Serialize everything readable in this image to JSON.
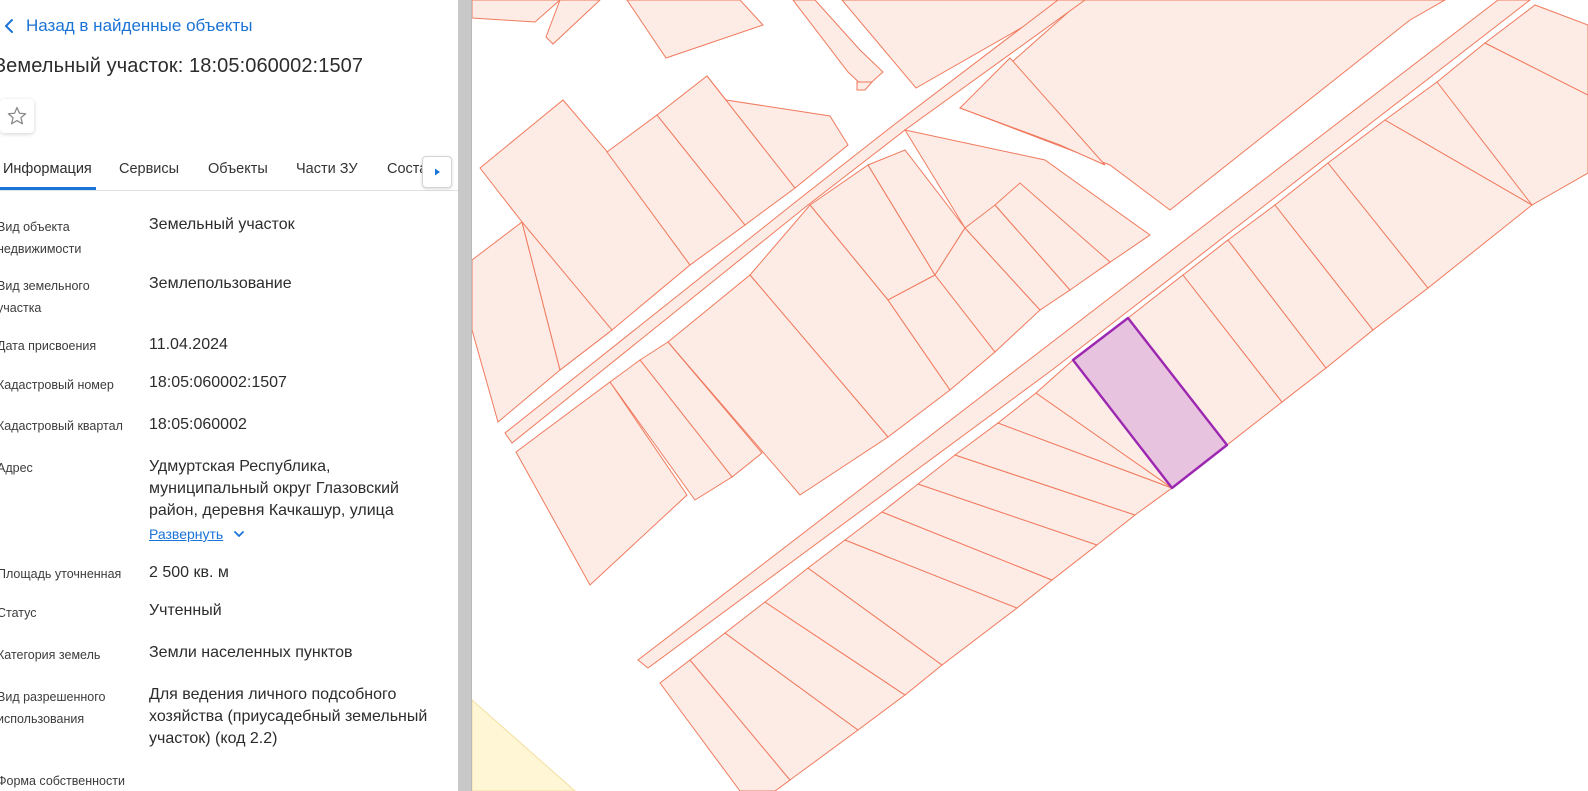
{
  "back_link": {
    "label": "Назад в найденные объекты"
  },
  "title": "Земельный участок: 18:05:060002:1507",
  "tabs": [
    {
      "label": "Информация",
      "active": true
    },
    {
      "label": "Сервисы",
      "active": false
    },
    {
      "label": "Объекты",
      "active": false
    },
    {
      "label": "Части ЗУ",
      "active": false
    },
    {
      "label": "Соста",
      "active": false
    }
  ],
  "properties": [
    {
      "label": "Вид объекта недвижимости",
      "value": "Земельный участок"
    },
    {
      "label": "Вид земельного участка",
      "value": "Землепользование"
    },
    {
      "label": "Дата присвоения",
      "value": "11.04.2024"
    },
    {
      "label": "Кадастровый номер",
      "value": "18:05:060002:1507"
    },
    {
      "label": "Кадастровый квартал",
      "value": "18:05:060002"
    },
    {
      "label": "Адрес",
      "value": "Удмуртская Республика, муниципальный округ Глазовский район, деревня Качкашур, улица"
    },
    {
      "label": "Площадь уточненная",
      "value": "2 500 кв. м"
    },
    {
      "label": "Статус",
      "value": "Учтенный"
    },
    {
      "label": "Категория земель",
      "value": "Земли населенных пунктов"
    },
    {
      "label": "Вид разрешенного использования",
      "value": "Для ведения личного подсобного хозяйства (приусадебный земельный участок) (код 2.2)"
    },
    {
      "label": "Форма собственности",
      "value": ""
    }
  ],
  "address_expand_label": "Развернуть",
  "colors": {
    "accent": "#1a73d6",
    "parcel_fill": "#fdece6",
    "parcel_stroke": "#f07a5e",
    "selected_fill": "#e8c3df",
    "selected_stroke": "#9c27b0",
    "adjacent_zone": "#fff6d5"
  },
  "icons": {
    "back": "chevron-left-icon",
    "favorite": "star-outline-icon",
    "tab_scroll": "caret-right-icon",
    "expand": "chevron-down-icon"
  }
}
